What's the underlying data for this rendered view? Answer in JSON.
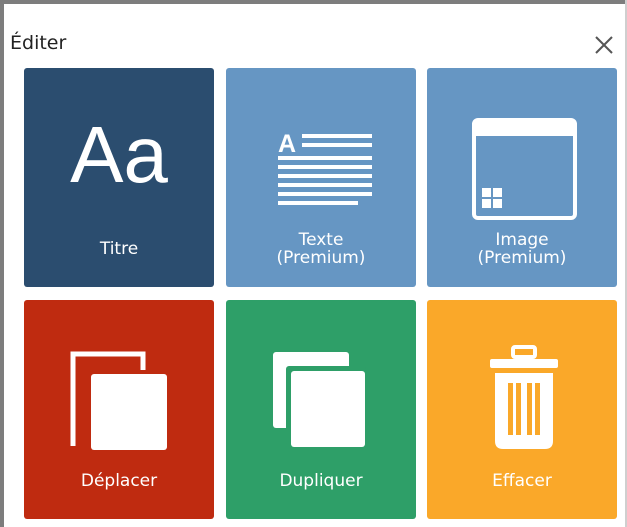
{
  "dialog": {
    "title": "Éditer",
    "close_icon": "close-icon"
  },
  "tiles": [
    {
      "id": "titre",
      "label": "Titre",
      "sub": "",
      "icon": "font-aa-icon",
      "color": "#2b4d6f",
      "glyph": "Aa"
    },
    {
      "id": "texte",
      "label": "Texte",
      "sub": "(Premium)",
      "icon": "text-block-icon",
      "color": "#6696c3"
    },
    {
      "id": "image",
      "label": "Image",
      "sub": "(Premium)",
      "icon": "image-window-icon",
      "color": "#6696c3"
    },
    {
      "id": "deplacer",
      "label": "Déplacer",
      "sub": "",
      "icon": "move-icon",
      "color": "#bf2b10"
    },
    {
      "id": "dupliquer",
      "label": "Dupliquer",
      "sub": "",
      "icon": "duplicate-icon",
      "color": "#2e9f68"
    },
    {
      "id": "effacer",
      "label": "Effacer",
      "sub": "",
      "icon": "trash-icon",
      "color": "#faa829"
    }
  ]
}
